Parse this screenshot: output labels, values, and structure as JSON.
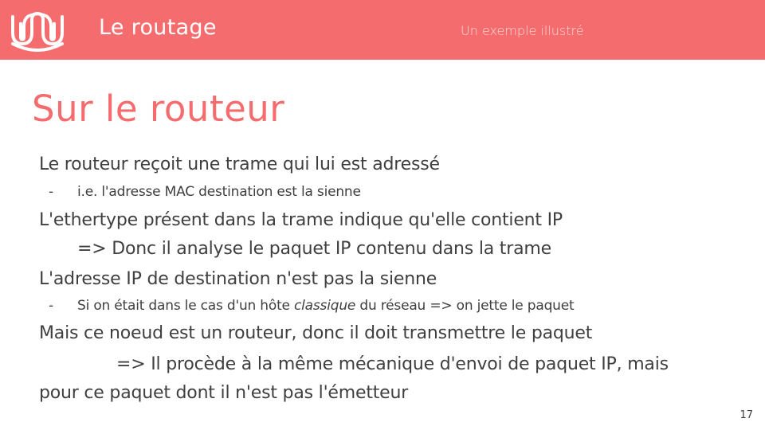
{
  "header": {
    "title": "Le routage",
    "subtitle": "Un exemple illustré",
    "accent_color": "#f56c6e",
    "logo_icon": "wavy-loop-logo-icon"
  },
  "slide": {
    "title": "Sur le routeur",
    "lines": [
      {
        "text": "Le routeur reçoit une trame qui lui est adressé"
      },
      {
        "bullet": "-",
        "text": "i.e. l'adresse MAC destination est la sienne"
      },
      {
        "text": "L'ethertype présent dans la trame indique qu'elle contient IP"
      },
      {
        "text": "=> Donc il analyse le paquet IP contenu dans la trame"
      },
      {
        "text": "L'adresse IP de destination n'est pas la sienne"
      },
      {
        "bullet": "-",
        "text_before": "Si on était dans le cas d'un hôte ",
        "text_em": "classique",
        "text_after": " du réseau => on jette le paquet"
      },
      {
        "text": "Mais ce noeud est un routeur, donc il doit transmettre le paquet"
      },
      {
        "text": "=> Il procède à la même mécanique d'envoi de paquet IP, mais"
      },
      {
        "text": "pour ce paquet dont il n'est pas l'émetteur"
      }
    ],
    "page_number": "17"
  }
}
